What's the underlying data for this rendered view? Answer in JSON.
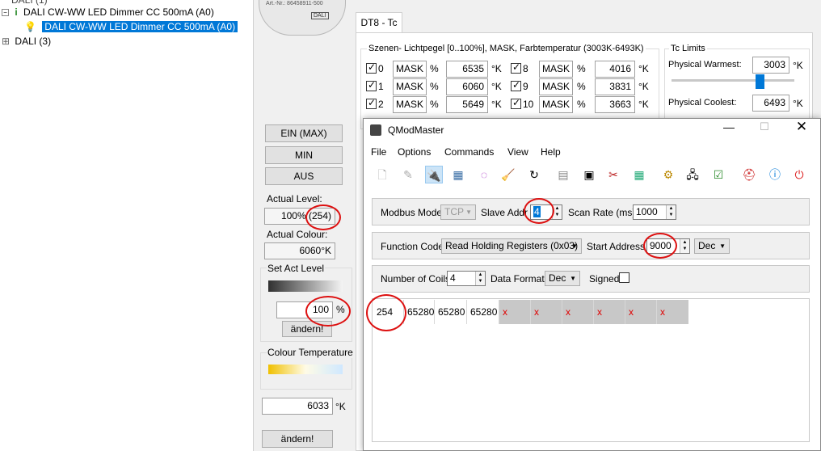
{
  "tree": {
    "top_partial": "DALI (1)",
    "device_parent": "DALI CW-WW LED Dimmer CC 500mA (A0)",
    "device_selected": "DALI CW-WW LED Dimmer CC 500mA (A0)",
    "dali3": "DALI (3)"
  },
  "device_image": {
    "art_nr": "Art.-Nr.: 86458911-500",
    "brand": "DALI"
  },
  "left": {
    "ein_label": "EIN (MAX)",
    "min_label": "MIN",
    "aus_label": "AUS",
    "actual_level_label": "Actual Level:",
    "actual_level_value": "100% (254)",
    "actual_colour_label": "Actual Colour:",
    "actual_colour_value": "6060°K",
    "set_act_level_label": "Set Act Level",
    "set_act_level_value": "100",
    "percent": "%",
    "aendern1": "ändern!",
    "colour_temp_label": "Colour Temperature",
    "colour_temp_value": "6033",
    "kelvin": "°K",
    "aendern2": "ändern!",
    "level_slider_fraction": 1.0,
    "colour_slider_fraction": 0.86
  },
  "dt8": {
    "tab_label": "DT8 - Tc",
    "scenes_title": "Szenen- Lichtpegel [0..100%], MASK, Farbtemperatur (3003K-6493K)",
    "mask": "MASK",
    "pct": "%",
    "k": "°K",
    "scenes": [
      {
        "num": "0",
        "temp": "6535"
      },
      {
        "num": "1",
        "temp": "6060"
      },
      {
        "num": "2",
        "temp": "5649"
      },
      {
        "num": "8",
        "temp": "4016"
      },
      {
        "num": "9",
        "temp": "3831"
      },
      {
        "num": "10",
        "temp": "3663"
      }
    ],
    "tc_limits_title": "Tc Limits",
    "physical_warmest_label": "Physical Warmest:",
    "physical_warmest_value": "3003",
    "physical_coolest_label": "Physical Coolest:",
    "physical_coolest_value": "6493"
  },
  "qmm": {
    "title": "QModMaster",
    "menu": [
      "File",
      "Options",
      "Commands",
      "View",
      "Help"
    ],
    "modbus_mode_label": "Modbus Mode",
    "modbus_mode_value": "TCP",
    "slave_addr_label": "Slave Addr",
    "slave_addr_value": "4",
    "scan_rate_label": "Scan Rate (ms)",
    "scan_rate_value": "1000",
    "function_code_label": "Function Code",
    "function_code_value": "Read Holding Registers (0x03)",
    "start_address_label": "Start Address",
    "start_address_value": "9000",
    "start_address_format": "Dec",
    "num_coils_label": "Number of Coils",
    "num_coils_value": "4",
    "data_format_label": "Data Format",
    "data_format_value": "Dec",
    "signed_label": "Signed",
    "results": [
      "254",
      "65280",
      "65280",
      "65280"
    ],
    "x_mark": "x"
  },
  "colors": {
    "accent": "#0078d7",
    "annotation": "#dd1111"
  }
}
